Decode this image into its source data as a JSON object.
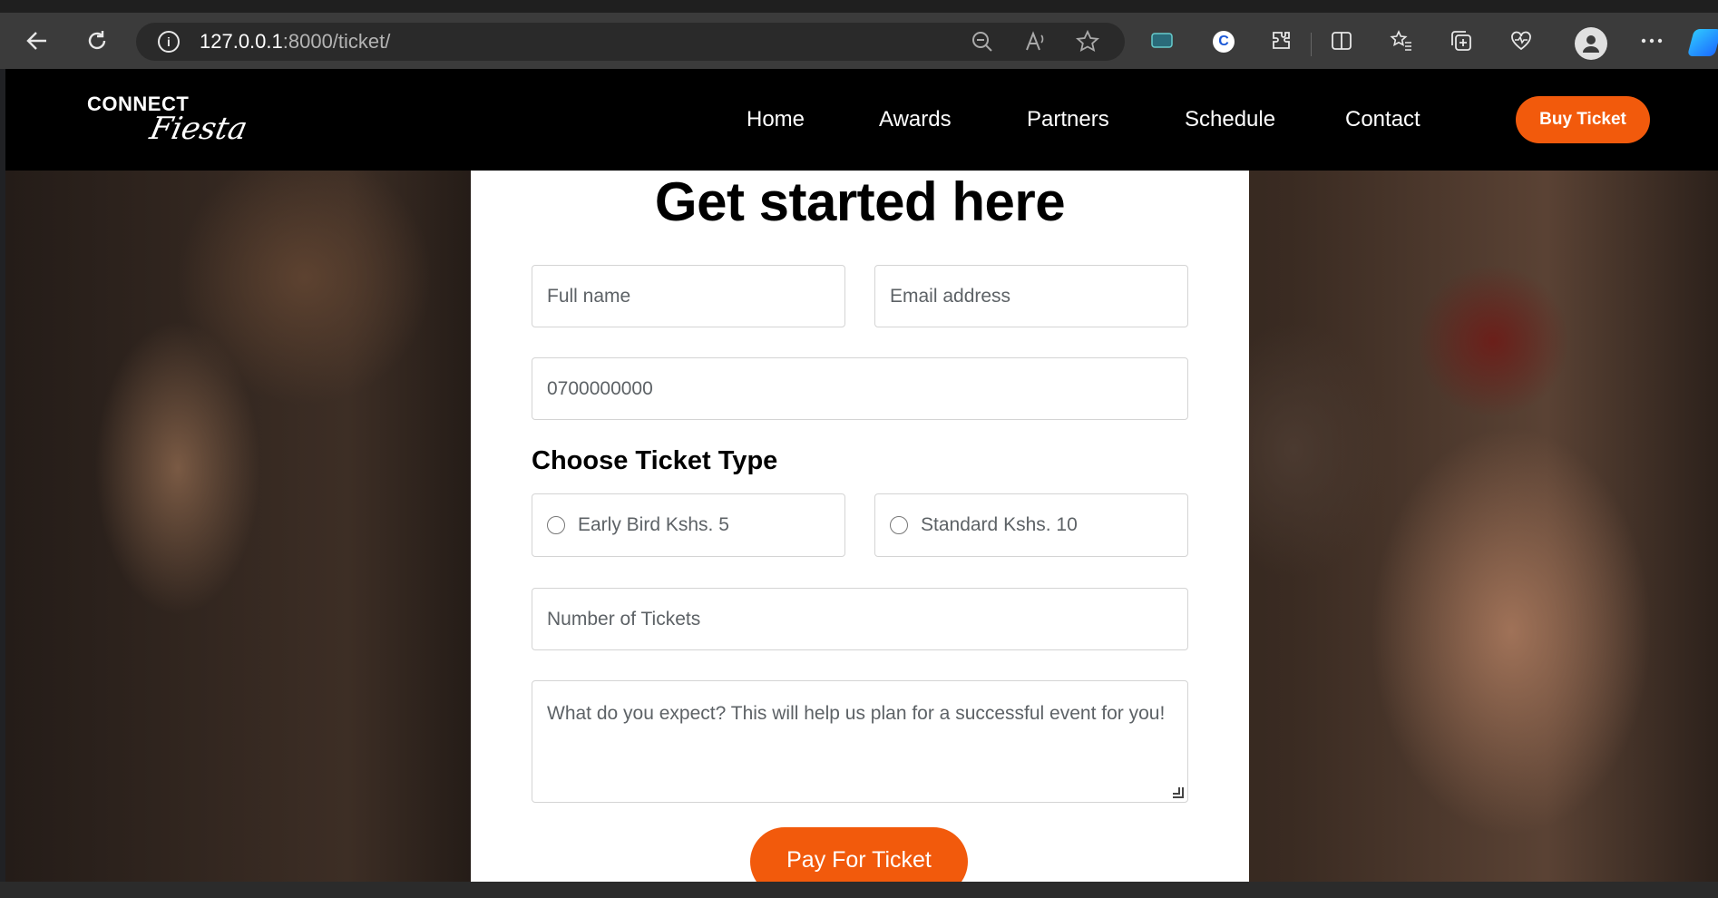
{
  "browser": {
    "url_host": "127.0.0.1",
    "url_path": ":8000/ticket/",
    "avatar_initial": "●",
    "extension_letter": "C"
  },
  "nav": {
    "logo_top": "CONNECT",
    "logo_script": "Fiesta",
    "links": [
      "Home",
      "Awards",
      "Partners",
      "Schedule",
      "Contact"
    ],
    "cta": "Buy Ticket"
  },
  "form": {
    "title": "Get started here",
    "full_name_placeholder": "Full name",
    "email_placeholder": "Email address",
    "phone_placeholder": "0700000000",
    "ticket_type_heading": "Choose Ticket Type",
    "ticket_options": [
      "Early Bird Kshs. 5",
      "Standard Kshs. 10"
    ],
    "tickets_placeholder": "Number of Tickets",
    "expectations_placeholder": "What do you expect? This will help us plan for a successful event for you!",
    "submit_label": "Pay For Ticket"
  },
  "colors": {
    "accent": "#f25a0c",
    "navbar_bg": "#000000",
    "card_bg": "#ffffff"
  }
}
